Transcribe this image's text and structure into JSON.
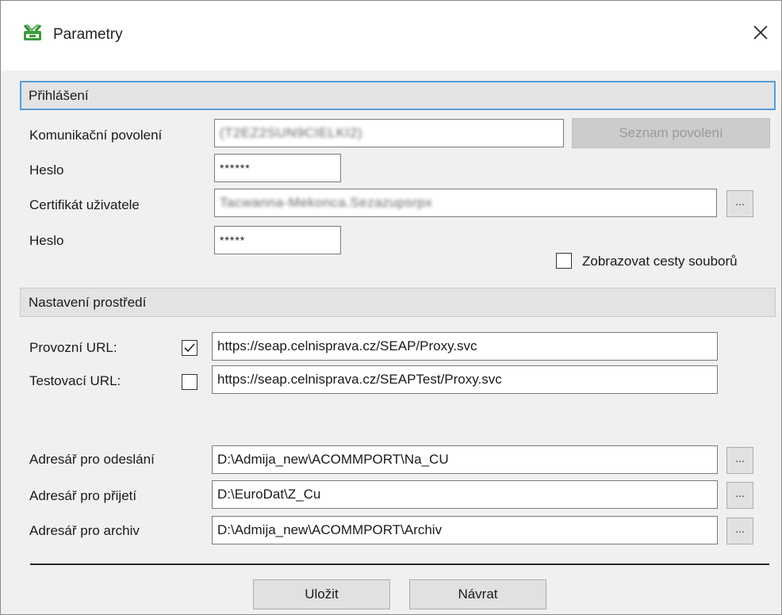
{
  "window": {
    "title": "Parametry",
    "close_glyph": "✕",
    "app_icon": "toolbox-icon"
  },
  "login": {
    "header": "Přihlášení",
    "comm_permit_label": "Komunikační povolení",
    "comm_permit_value": "(T2EZ2SUN9CIELKI2)",
    "permit_list_button": "Seznam povolení",
    "password1_label": "Heslo",
    "password1_value": "******",
    "certificate_label": "Certifikát uživatele",
    "certificate_value": "Tacwanna-Mekonca.Sezazupsrpx",
    "certificate_browse": "...",
    "password2_label": "Heslo",
    "password2_value": "*****",
    "show_paths_label": "Zobrazovat cesty souborů",
    "show_paths_checked": false
  },
  "environment": {
    "header": "Nastavení prostředí",
    "prod_url_label": "Provozní URL:",
    "prod_url_checked": true,
    "prod_url_value": "https://seap.celnisprava.cz/SEAP/Proxy.svc",
    "test_url_label": "Testovací URL:",
    "test_url_checked": false,
    "test_url_value": "https://seap.celnisprava.cz/SEAPTest/Proxy.svc"
  },
  "directories": {
    "send_label": "Adresář pro odeslání",
    "send_value": "D:\\Admija_new\\ACOMMPORT\\Na_CU",
    "receive_label": "Adresář pro přijetí",
    "receive_value": "D:\\EuroDat\\Z_Cu",
    "archive_label": "Adresář pro archiv",
    "archive_value": "D:\\Admija_new\\ACOMMPORT\\Archiv",
    "browse_label": "..."
  },
  "footer": {
    "save_label": "Uložit",
    "back_label": "Návrat"
  },
  "colors": {
    "active_border": "#5b9bd5",
    "section_bg": "#e3e3e3",
    "dialog_bg": "#f0f0f0"
  }
}
